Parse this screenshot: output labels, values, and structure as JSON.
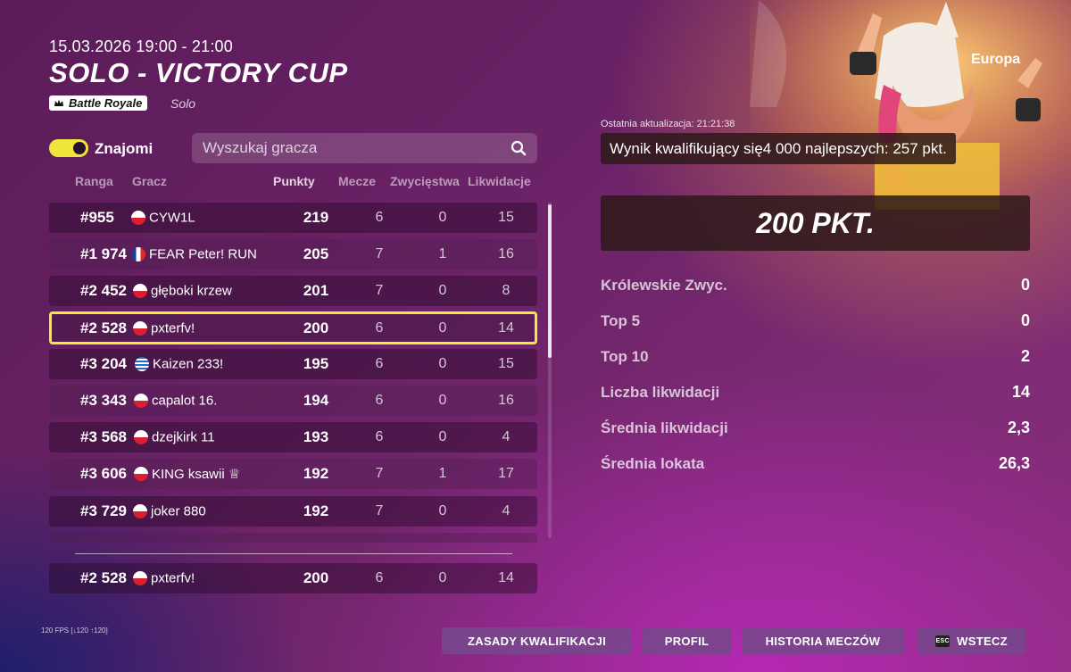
{
  "event": {
    "date": "15.03.2026 19:00 - 21:00",
    "title": "SOLO - VICTORY CUP",
    "mode_badge": "Battle Royale",
    "mode_sub": "Solo"
  },
  "filters": {
    "friends_label": "Znajomi",
    "friends_toggle_on": true,
    "search_placeholder": "Wyszukaj gracza"
  },
  "columns": {
    "rank": "Ranga",
    "player": "Gracz",
    "points": "Punkty",
    "matches": "Mecze",
    "wins": "Zwycięstwa",
    "eliminations": "Likwidacje"
  },
  "leaderboard": [
    {
      "rank": "#955",
      "flag": "pl",
      "name": "CYW1L",
      "points": "219",
      "matches": "6",
      "wins": "0",
      "elims": "15"
    },
    {
      "rank": "#1 974",
      "flag": "fr",
      "name": "FEAR Peter! RUN",
      "points": "205",
      "matches": "7",
      "wins": "1",
      "elims": "16"
    },
    {
      "rank": "#2 452",
      "flag": "pl",
      "name": "głęboki krzew",
      "points": "201",
      "matches": "7",
      "wins": "0",
      "elims": "8"
    },
    {
      "rank": "#2 528",
      "flag": "pl",
      "name": "pxterfv!",
      "points": "200",
      "matches": "6",
      "wins": "0",
      "elims": "14"
    },
    {
      "rank": "#3 204",
      "flag": "gr",
      "name": "Kaizen 233!",
      "points": "195",
      "matches": "6",
      "wins": "0",
      "elims": "15"
    },
    {
      "rank": "#3 343",
      "flag": "pl",
      "name": "capalot 16.",
      "points": "194",
      "matches": "6",
      "wins": "0",
      "elims": "16"
    },
    {
      "rank": "#3 568",
      "flag": "pl",
      "name": "dzejkirk 11",
      "points": "193",
      "matches": "6",
      "wins": "0",
      "elims": "4"
    },
    {
      "rank": "#3 606",
      "flag": "pl",
      "name": "KING ksawii ♕",
      "points": "192",
      "matches": "7",
      "wins": "1",
      "elims": "17"
    },
    {
      "rank": "#3 729",
      "flag": "pl",
      "name": "joker 880",
      "points": "192",
      "matches": "7",
      "wins": "0",
      "elims": "4"
    }
  ],
  "my_row": {
    "rank": "#2 528",
    "flag": "pl",
    "name": "pxterfv!",
    "points": "200",
    "matches": "6",
    "wins": "0",
    "elims": "14"
  },
  "summary": {
    "region": "Europa",
    "last_update": "Ostatnia aktualizacja: 21:21:38",
    "qualifying": "Wynik kwalifikujący się4 000 najlepszych: 257 pkt.",
    "score": "200 PKT.",
    "stats": [
      {
        "label": "Królewskie Zwyc.",
        "value": "0"
      },
      {
        "label": "Top 5",
        "value": "0"
      },
      {
        "label": "Top 10",
        "value": "2"
      },
      {
        "label": "Liczba likwidacji",
        "value": "14"
      },
      {
        "label": "Średnia likwidacji",
        "value": "2,3"
      },
      {
        "label": "Średnia lokata",
        "value": "26,3"
      }
    ]
  },
  "footer": {
    "fps": "120 FPS [↓120 ↑120]",
    "btn_rules": "ZASADY KWALIFIKACJI",
    "btn_profile": "PROFIL",
    "btn_history": "HISTORIA MECZÓW",
    "btn_back": "WSTECZ",
    "back_key": "ESC"
  },
  "icons": {
    "search": "search-icon",
    "mode": "crown-icon",
    "key": "esc-key-icon"
  },
  "colors": {
    "highlight": "#f3e93a",
    "toggle": "#f0e53a"
  }
}
